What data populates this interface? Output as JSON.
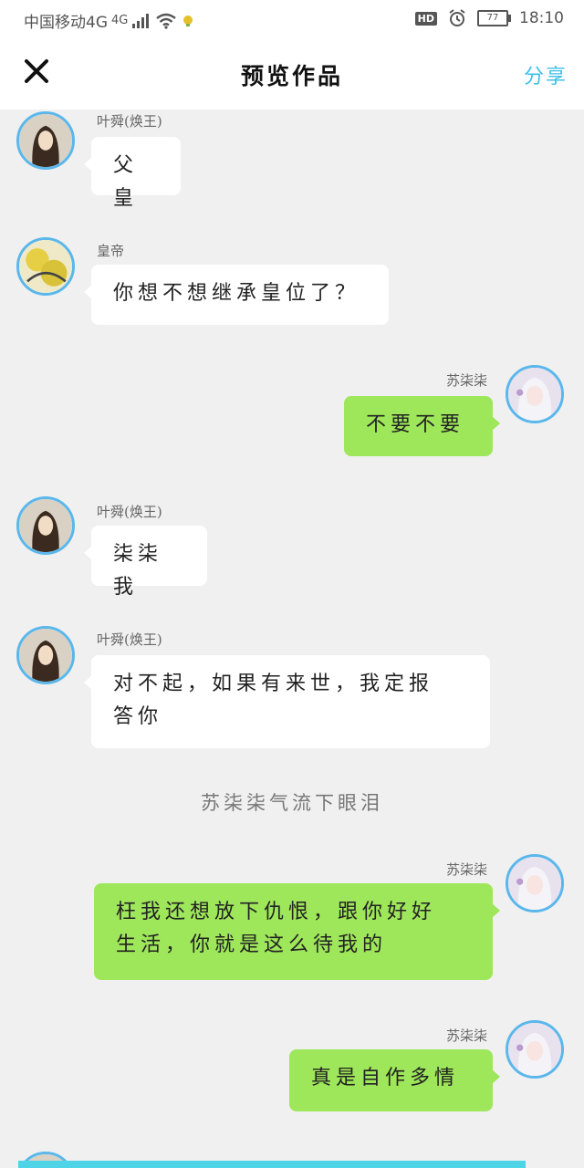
{
  "status_bar": {
    "carrier": "中国移动4G",
    "network": "4G",
    "hd": "HD",
    "battery": "77",
    "time": "18:10"
  },
  "nav": {
    "title": "预览作品",
    "share_label": "分享",
    "close_icon": "close-icon"
  },
  "messages": [
    {
      "name": "叶舜(焕王)",
      "text": "父皇",
      "side": "left",
      "avatar": "avatar-yeshun"
    },
    {
      "name": "皇帝",
      "text": "你想不想继承皇位了？",
      "side": "left",
      "avatar": "avatar-emperor"
    },
    {
      "name": "苏柒柒",
      "text": "不要不要",
      "side": "right",
      "avatar": "avatar-suqiqi"
    },
    {
      "name": "叶舜(焕王)",
      "text": "柒柒我",
      "side": "left",
      "avatar": "avatar-yeshun"
    },
    {
      "name": "叶舜(焕王)",
      "text_line1": "对不起，如果有来世，我定报",
      "text_line2": "答你",
      "side": "left",
      "avatar": "avatar-yeshun"
    },
    {
      "name": "苏柒柒",
      "text_line1": "枉我还想放下仇恨，跟你好好",
      "text_line2": "生活，你就是这么待我的",
      "side": "right",
      "avatar": "avatar-suqiqi"
    },
    {
      "name": "苏柒柒",
      "text": "真是自作多情",
      "side": "right",
      "avatar": "avatar-suqiqi"
    }
  ],
  "narration": "苏柒柒气流下眼泪",
  "colors": {
    "accent": "#3fc0e8",
    "right_bubble": "#9ee65a",
    "avatar_border": "#5ab7ec"
  }
}
